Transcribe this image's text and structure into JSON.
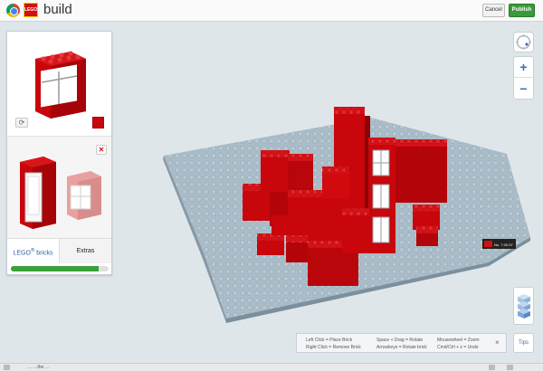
{
  "header": {
    "app_title": "build",
    "cancel_label": "Cancel",
    "publish_label": "Publish",
    "logo_text": "LEGO"
  },
  "panel": {
    "selected_color": "#c8060b",
    "tabs": [
      {
        "label": "LEGO",
        "superscript": "®",
        "suffix": " bricks",
        "active": true
      },
      {
        "label": "Extras",
        "active": false
      }
    ],
    "progress": 0.9
  },
  "map_controls": {
    "zoom_in": "+",
    "zoom_out": "−",
    "tips_label": "Tips"
  },
  "help": {
    "left_click": "Left Click = Place Brick",
    "right_click": "Right Click = Remove Brick",
    "space_drag": "Space + Drag = Rotate",
    "arrowkeys": "Arrowkeys = Rotate brick",
    "mousewheel": "Mousewheel = Zoom",
    "undo": "Cmd/Ctrl + z = Undo",
    "close": "×"
  },
  "plate_label": "No. 7.00.07",
  "taskbar": {
    "text": "… …the …"
  },
  "colors": {
    "brick_red": "#c8060b",
    "plate_blue_gray": "#a9bcc8",
    "accent_blue": "#3b6fb6",
    "publish_green": "#399b39"
  }
}
